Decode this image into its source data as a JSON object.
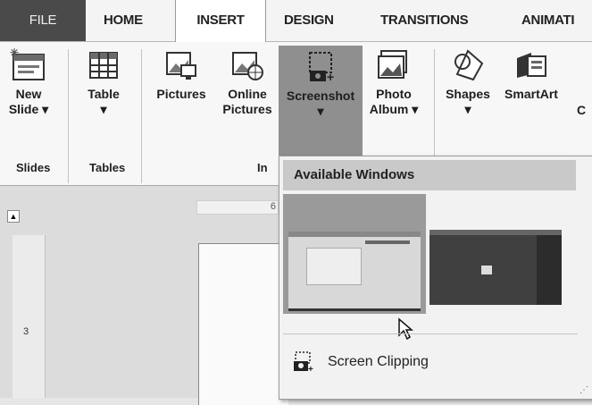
{
  "tabs": [
    {
      "id": "file",
      "label": "FILE"
    },
    {
      "id": "home",
      "label": "HOME"
    },
    {
      "id": "insert",
      "label": "INSERT"
    },
    {
      "id": "design",
      "label": "DESIGN"
    },
    {
      "id": "transitions",
      "label": "TRANSITIONS"
    },
    {
      "id": "animations",
      "label": "ANIMATI"
    }
  ],
  "ribbon": {
    "new_slide": {
      "line1": "New",
      "line2": "Slide ▾"
    },
    "table": {
      "line1": "Table",
      "line2": "▾"
    },
    "pictures": {
      "line1": "Pictures"
    },
    "online_pictures": {
      "line1": "Online",
      "line2": "Pictures"
    },
    "screenshot": {
      "line1": "Screenshot",
      "line2": "▾"
    },
    "photo_album": {
      "line1": "Photo",
      "line2": "Album ▾"
    },
    "shapes": {
      "line1": "Shapes",
      "line2": "▾"
    },
    "smartart": {
      "line1": "SmartArt"
    },
    "chart_partial": {
      "line1": "C"
    },
    "groups": {
      "slides": "Slides",
      "tables": "Tables",
      "images": "In"
    }
  },
  "ruler": {
    "h_mark": "6",
    "v_mark": "3"
  },
  "dropdown": {
    "header": "Available Windows",
    "screen_clipping": "Screen Clipping"
  },
  "colors": {
    "highlight": "#8f8f8f",
    "file_tab": "#4a4a4a"
  }
}
